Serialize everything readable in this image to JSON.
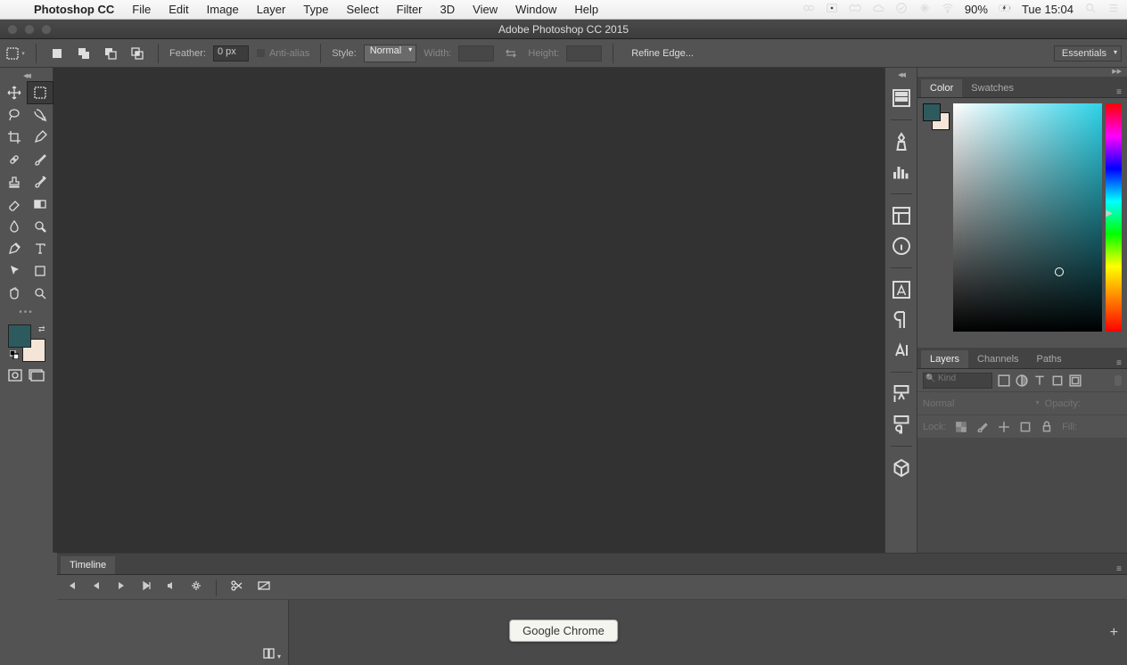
{
  "mac_menu": {
    "app": "Photoshop CC",
    "items": [
      "File",
      "Edit",
      "Image",
      "Layer",
      "Type",
      "Select",
      "Filter",
      "3D",
      "View",
      "Window",
      "Help"
    ],
    "battery": "90%",
    "clock": "Tue 15:04"
  },
  "window": {
    "title": "Adobe Photoshop CC 2015"
  },
  "options_bar": {
    "feather_label": "Feather:",
    "feather_value": "0 px",
    "antialias_label": "Anti-alias",
    "style_label": "Style:",
    "style_value": "Normal",
    "width_label": "Width:",
    "height_label": "Height:",
    "refine_label": "Refine Edge...",
    "workspace": "Essentials"
  },
  "colors": {
    "foreground": "#2d5a5f",
    "background": "#f5e5d8"
  },
  "panels": {
    "color_tabs": {
      "color": "Color",
      "swatches": "Swatches"
    },
    "layers_tabs": {
      "layers": "Layers",
      "channels": "Channels",
      "paths": "Paths"
    },
    "layers_filter_placeholder": "Kind",
    "blend_mode": "Normal",
    "opacity_label": "Opacity:",
    "lock_label": "Lock:",
    "fill_label": "Fill:"
  },
  "timeline": {
    "tab": "Timeline"
  },
  "tooltip": "Google Chrome"
}
